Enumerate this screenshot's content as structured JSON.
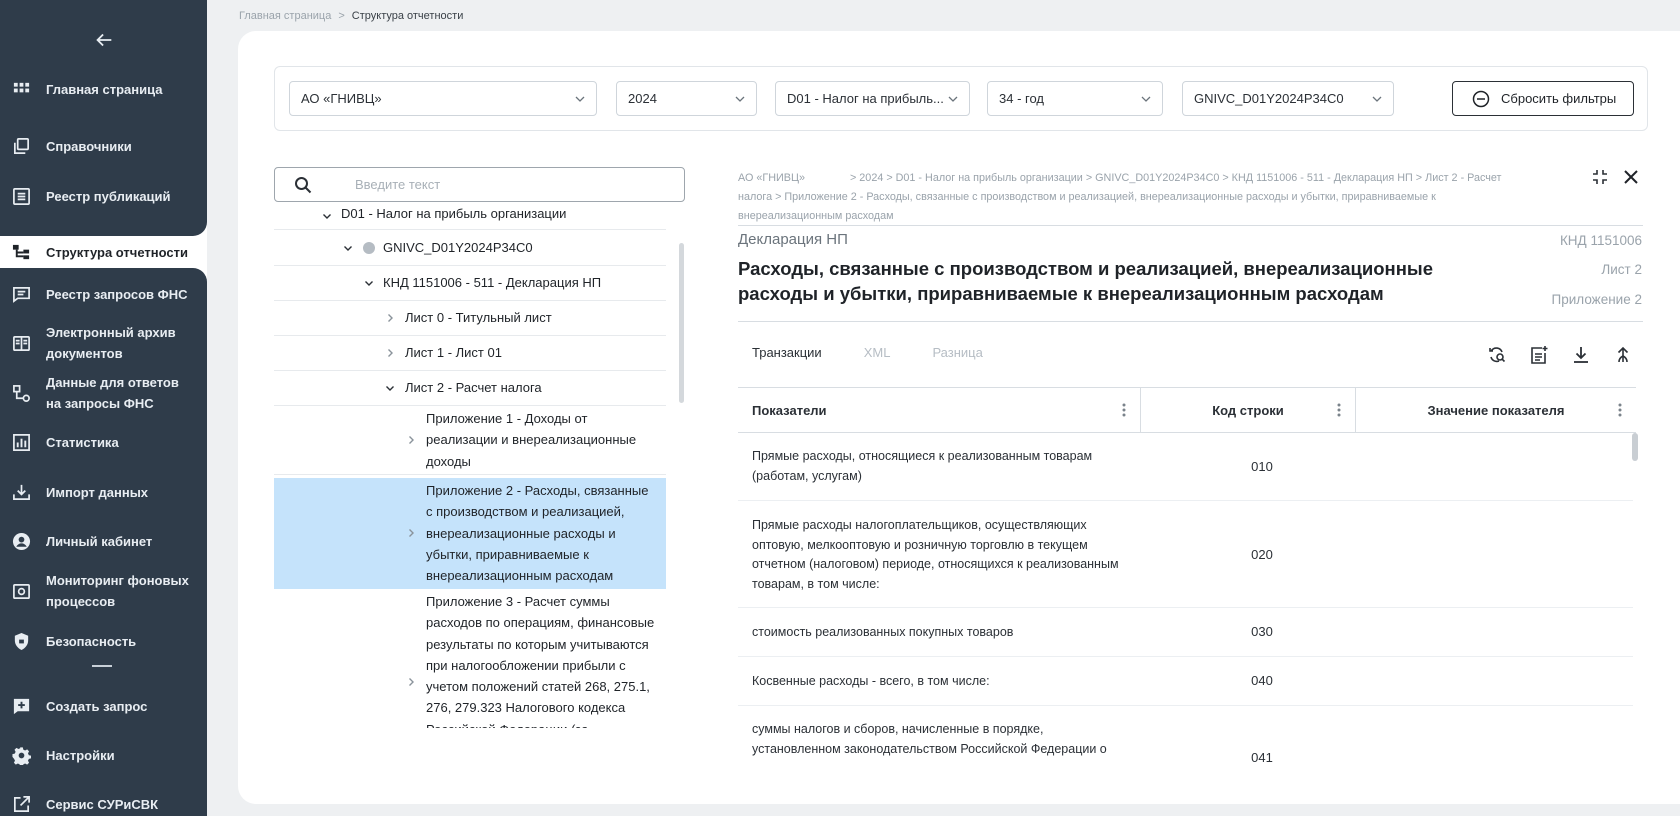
{
  "sidebar": {
    "items": [
      {
        "label": "Главная страница",
        "icon": "grid-icon"
      },
      {
        "label": "Справочники",
        "icon": "books-icon"
      },
      {
        "label": "Реестр публикаций",
        "icon": "list-icon"
      },
      {
        "label": "Структура отчетности",
        "icon": "structure-icon",
        "active": true
      },
      {
        "label": "Реестр запросов ФНС",
        "icon": "chat-list-icon"
      },
      {
        "label": "Электронный архив документов",
        "icon": "archive-icon"
      },
      {
        "label": "Данные для ответов на запросы ФНС",
        "icon": "data-flow-icon"
      },
      {
        "label": "Статистика",
        "icon": "bar-chart-icon"
      },
      {
        "label": "Импорт данных",
        "icon": "import-icon"
      },
      {
        "label": "Личный кабинет",
        "icon": "user-icon"
      },
      {
        "label": "Мониторинг фоновых процессов",
        "icon": "monitor-icon"
      },
      {
        "label": "Безопасность",
        "icon": "shield-icon"
      },
      {
        "label": "Создать запрос",
        "icon": "add-request-icon"
      },
      {
        "label": "Настройки",
        "icon": "gear-icon"
      },
      {
        "label": "Сервис СУРиСВК",
        "icon": "external-link-icon"
      }
    ]
  },
  "breadcrumb": {
    "home": "Главная страница",
    "sep": ">",
    "current": "Структура отчетности"
  },
  "filters": {
    "organization": "АО «ГНИВЦ»",
    "year": "2024",
    "tax": "D01 - Налог на прибыль...",
    "period": "34 - год",
    "code": "GNIVC_D01Y2024P34C0",
    "reset_label": "Сбросить фильтры"
  },
  "tree": {
    "search_placeholder": "Введите текст",
    "rows": [
      "D01 - Налог на прибыль организации",
      "GNIVC_D01Y2024P34C0",
      "КНД 1151006 - 511 - Декларация НП",
      "Лист 0 - Титульный лист",
      "Лист 1 - Лист 01",
      "Лист 2 - Расчет налога",
      "Приложение 1 - Доходы от реализации и внереализационные доходы",
      "Приложение 2 - Расходы, связанные с производством и реализацией, внереализационные расходы и убытки, приравниваемые к внереализационным расходам",
      "Приложение 3 - Расчет суммы расходов по операциям, финансовые результаты по которым учитываются при налогообложении прибыли с учетом положений статей 268, 275.1, 276, 279.323 Налогового кодекса Российской Федерации (за"
    ],
    "row0_short": "D01 - Налог на прибыль организации"
  },
  "detail": {
    "path_org": "АО «ГНИВЦ»",
    "path_rest": "> 2024 > D01 - Налог на прибыль организации > GNIVC_D01Y2024P34C0 > КНД 1151006 - 511 - Декларация НП > Лист 2 - Расчет налога > Приложение 2 - Расходы, связанные с производством и реализацией, внереализационные расходы и убытки, приравниваемые к внереализационным расходам",
    "doc_type": "Декларация НП",
    "knd": "КНД 1151006",
    "list": "Лист 2",
    "appendix": "Приложение 2",
    "title": "Расходы, связанные с производством и реализацией, внереализационные расходы и убытки, приравниваемые к внереализационным расходам",
    "tabs": [
      "Транзакции",
      "XML",
      "Разница"
    ],
    "table": {
      "headers": [
        "Показатели",
        "Код строки",
        "Значение показателя"
      ],
      "rows": [
        {
          "name": "Прямые расходы, относящиеся к реализованным товарам (работам, услугам)",
          "code": "010"
        },
        {
          "name": "Прямые расходы налогоплательщиков, осуществляющих оптовую, мелкооптовую и розничную торговлю в текущем отчетном (налоговом) периоде, относящихся к реализованным товарам, в том числе:",
          "code": "020"
        },
        {
          "name": "стоимость реализованных покупных товаров",
          "code": "030"
        },
        {
          "name": "Косвенные расходы - всего, в том числе:",
          "code": "040"
        },
        {
          "name": "суммы налогов и сборов, начисленные в порядке, установленном законодательством Российской Федерации о",
          "code": "041"
        }
      ]
    }
  },
  "colors": {
    "sidebar_bg": "#2f3c4a",
    "selected_row": "#c5e3fb"
  }
}
